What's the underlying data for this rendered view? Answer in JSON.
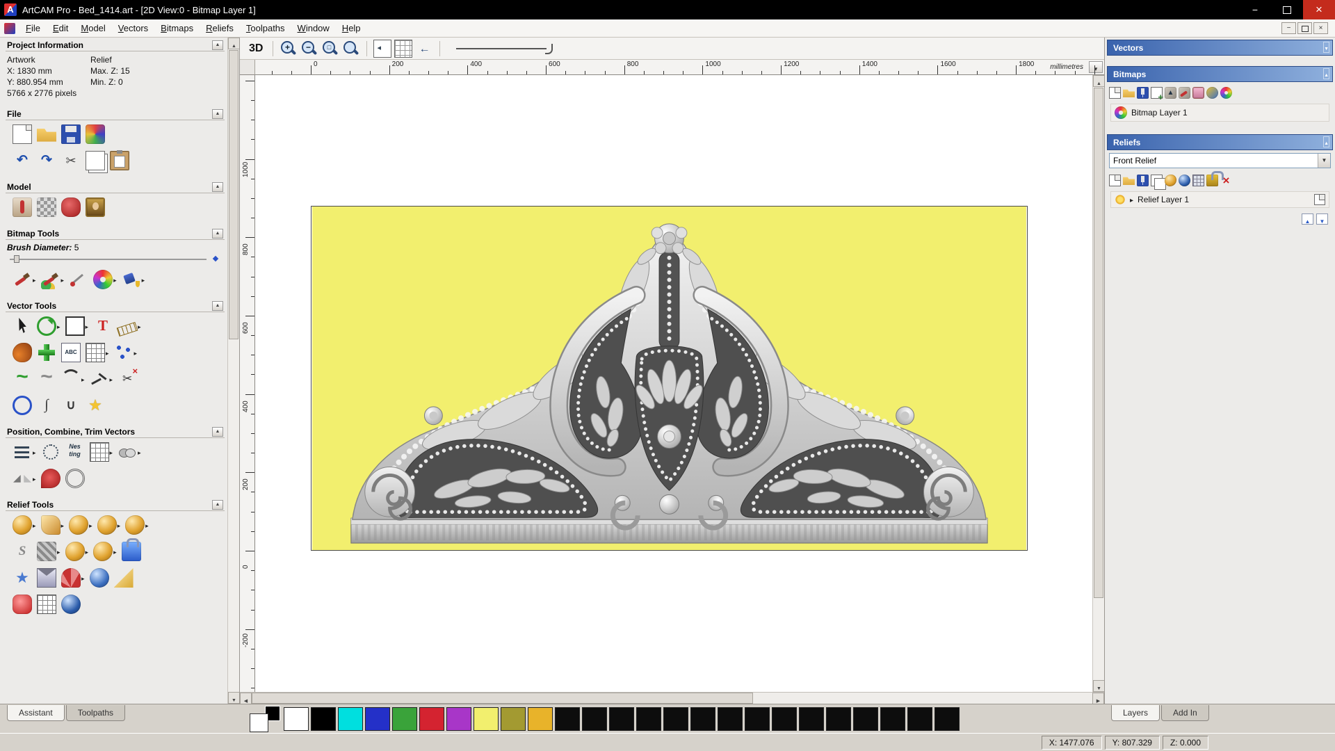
{
  "titlebar": {
    "title": "ArtCAM Pro - Bed_1414.art - [2D View:0 - Bitmap Layer 1]"
  },
  "menu": {
    "items": [
      "File",
      "Edit",
      "Model",
      "Vectors",
      "Bitmaps",
      "Reliefs",
      "Toolpaths",
      "Window",
      "Help"
    ]
  },
  "assistant": {
    "project": {
      "title": "Project Information",
      "artwork_label": "Artwork",
      "relief_label": "Relief",
      "x": "X: 1830 mm",
      "y": "Y: 880.954 mm",
      "pixels": "5766 x 2776 pixels",
      "max_z": "Max. Z: 15",
      "min_z": "Min. Z: 0"
    },
    "file": {
      "title": "File",
      "row1": [
        "new-model",
        "open-file",
        "save-model",
        "import-export"
      ],
      "row2": [
        "undo",
        "redo",
        "cut",
        "copy",
        "paste"
      ]
    },
    "model": {
      "title": "Model",
      "row1": [
        "mannequin",
        "pixel-grid",
        "sculpt-figure",
        "portrait"
      ]
    },
    "bitmap": {
      "title": "Bitmap Tools",
      "brush_label": "Brush Diameter:",
      "brush_value": "5",
      "row1": [
        "paint>",
        "paint-all>",
        "colour-picker",
        "palette>",
        "flood-fill>"
      ]
    },
    "vector": {
      "title": "Vector Tools",
      "row1": [
        "select",
        "transform>",
        "create-rectangle>",
        "create-text",
        "measure>"
      ],
      "row2": [
        "slipper",
        "green-cross",
        "abc-text",
        "grid>",
        "node-edit>"
      ],
      "row3": [
        "freehand",
        "smooth-curve",
        "arc>",
        "polyline>",
        "trim-vectors"
      ],
      "row4": [
        "create-circle",
        "bezier",
        "join-vectors",
        "create-star"
      ]
    },
    "position": {
      "title": "Position, Combine, Trim Vectors",
      "row1": [
        "align>",
        "paste-along-curve",
        "nesting",
        "block-copy>",
        "weld>"
      ],
      "row2": [
        "mirror>",
        "trim-weld",
        "wrap"
      ]
    },
    "relief": {
      "title": "Relief Tools",
      "row1": [
        "shape-editor>",
        "smooth-relief>",
        "sculpt-gold>",
        "spin-relief>",
        "angle-relief>"
      ],
      "row2": [
        "smooth-s",
        "weave-relief>",
        "relief-clipart>",
        "interactive-sculpt>",
        "relief-lock"
      ],
      "row3": [
        "star-relief",
        "envelope",
        "fan-relief>",
        "texture-relief",
        "wedge-relief"
      ],
      "row4": [
        "extrude",
        "turn-relief",
        "spin-blue"
      ]
    },
    "tabs": [
      "Assistant",
      "Toolpaths"
    ]
  },
  "view": {
    "toolbar": {
      "view3d": "3D",
      "zoom_icons": [
        "zoom-in",
        "zoom-out",
        "zoom-object",
        "zoom-fit"
      ],
      "view_icons": [
        "page-flip",
        "page-grid",
        "view-back"
      ]
    },
    "ruler_unit": "millimetres",
    "ruler_top_labels": [
      0,
      200,
      400,
      600,
      800,
      1000,
      1200,
      1400,
      1600,
      1800
    ],
    "ruler_left_labels": [
      1000,
      800,
      600,
      400,
      200,
      0,
      -200
    ]
  },
  "layers_panel": {
    "vectors": {
      "title": "Vectors"
    },
    "bitmaps": {
      "title": "Bitmaps",
      "toolbar": [
        "new",
        "open",
        "save",
        "add-layer",
        "merge-up",
        "paint-mini",
        "erase",
        "to-relief",
        "palette-mini"
      ],
      "layers": [
        {
          "name": "Bitmap Layer 1"
        }
      ]
    },
    "reliefs": {
      "title": "Reliefs",
      "combo": "Front Relief",
      "toolbar": [
        "new",
        "open",
        "save",
        "duplicate",
        "gold-mini",
        "scale-z",
        "calc",
        "lock-mini",
        "delete"
      ],
      "layers": [
        {
          "name": "Relief Layer 1"
        }
      ]
    },
    "tabs": [
      "Layers",
      "Add In"
    ]
  },
  "palette": {
    "colors": [
      "#ffffff",
      "#000000",
      "#00dfdf",
      "#2430c8",
      "#3aa33a",
      "#d42330",
      "#a836c8",
      "#f2ef6e",
      "#a39a31",
      "#e8b32a",
      "#0d0d0d",
      "#0d0d0d",
      "#0d0d0d",
      "#0d0d0d",
      "#0d0d0d",
      "#0d0d0d",
      "#0d0d0d",
      "#0d0d0d",
      "#0d0d0d",
      "#0d0d0d",
      "#0d0d0d",
      "#0d0d0d",
      "#0d0d0d",
      "#0d0d0d",
      "#0d0d0d"
    ]
  },
  "status": {
    "x": "X: 1477.076",
    "y": "Y: 807.329",
    "z": "Z: 0.000"
  },
  "colors": {
    "artwork_background": "#f2ef6e",
    "panel_header_start": "#3a63ad",
    "panel_header_end": "#8fb0dd"
  }
}
